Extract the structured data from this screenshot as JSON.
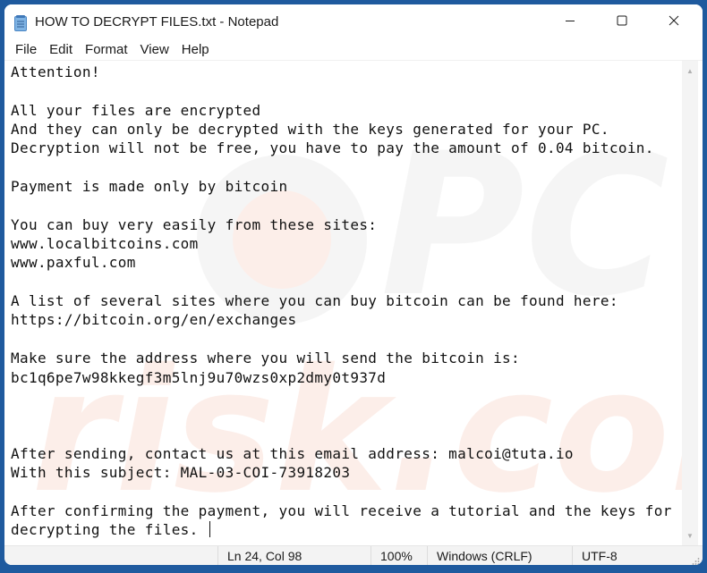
{
  "window": {
    "title": "HOW TO DECRYPT FILES.txt - Notepad",
    "app_icon": "notepad-icon",
    "controls": {
      "minimize": "minimize-icon",
      "maximize": "maximize-icon",
      "close": "close-icon"
    }
  },
  "menu": {
    "items": [
      {
        "label": "File"
      },
      {
        "label": "Edit"
      },
      {
        "label": "Format"
      },
      {
        "label": "View"
      },
      {
        "label": "Help"
      }
    ]
  },
  "editor": {
    "lines": [
      "Attention!",
      "",
      "All your files are encrypted",
      "And they can only be decrypted with the keys generated for your PC.",
      "Decryption will not be free, you have to pay the amount of 0.04 bitcoin.",
      "",
      "Payment is made only by bitcoin",
      "",
      "You can buy very easily from these sites:",
      "www.localbitcoins.com",
      "www.paxful.com",
      "",
      "A list of several sites where you can buy bitcoin can be found here:",
      "https://bitcoin.org/en/exchanges",
      "",
      "Make sure the address where you will send the bitcoin is:",
      "bc1q6pe7w98kkegf3m5lnj9u70wzs0xp2dmy0t937d",
      "",
      "",
      "",
      "After sending, contact us at this email address: malcoi@tuta.io",
      "With this subject: MAL-03-COI-73918203",
      "",
      "After confirming the payment, you will receive a tutorial and the keys for",
      "decrypting the files. "
    ],
    "watermark_text": "PC risk.com"
  },
  "status": {
    "position": "Ln 24, Col 98",
    "zoom": "100%",
    "line_endings": "Windows (CRLF)",
    "encoding": "UTF-8"
  },
  "colors": {
    "desktop": "#1f5a9e",
    "watermark": "#e8501e"
  }
}
